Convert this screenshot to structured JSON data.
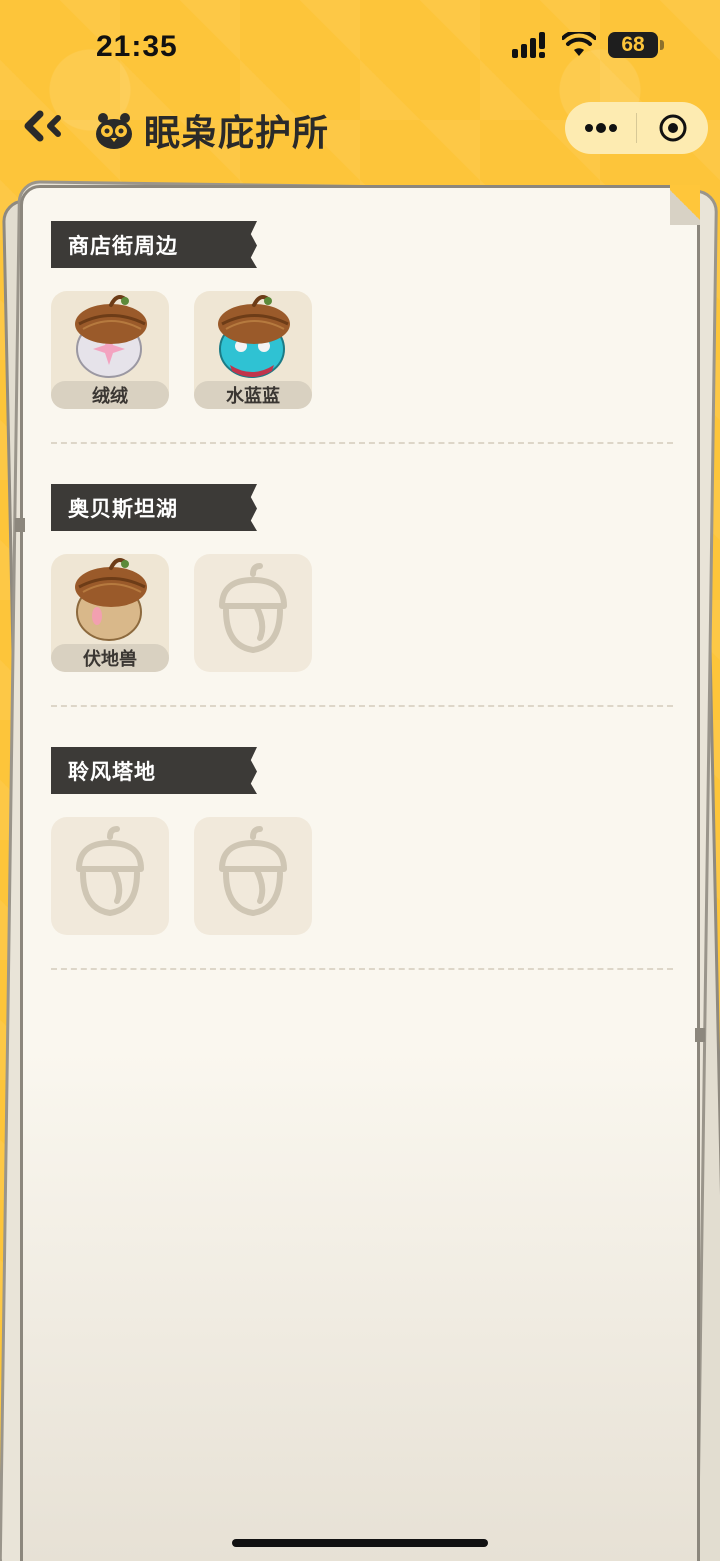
{
  "status_bar": {
    "time": "21:35",
    "battery": "68"
  },
  "nav": {
    "title": "眠枭庇护所"
  },
  "sections": [
    {
      "title": "商店街周边",
      "items": [
        {
          "name": "绒绒",
          "found": true,
          "body_color": "#e6e3ea",
          "accent": "#f3a3c0"
        },
        {
          "name": "水蓝蓝",
          "found": true,
          "body_color": "#2fc2d3",
          "accent": "#c0344b"
        }
      ]
    },
    {
      "title": "奥贝斯坦湖",
      "items": [
        {
          "name": "伏地兽",
          "found": true,
          "body_color": "#d9b88a",
          "accent": "#f2a0b0"
        },
        {
          "name": "",
          "found": false
        }
      ]
    },
    {
      "title": "聆风塔地",
      "items": [
        {
          "name": "",
          "found": false
        },
        {
          "name": "",
          "found": false
        }
      ]
    }
  ],
  "colors": {
    "background": "#fdc53a",
    "paper": "#faf7ef",
    "header_bar": "#3c3a37"
  }
}
